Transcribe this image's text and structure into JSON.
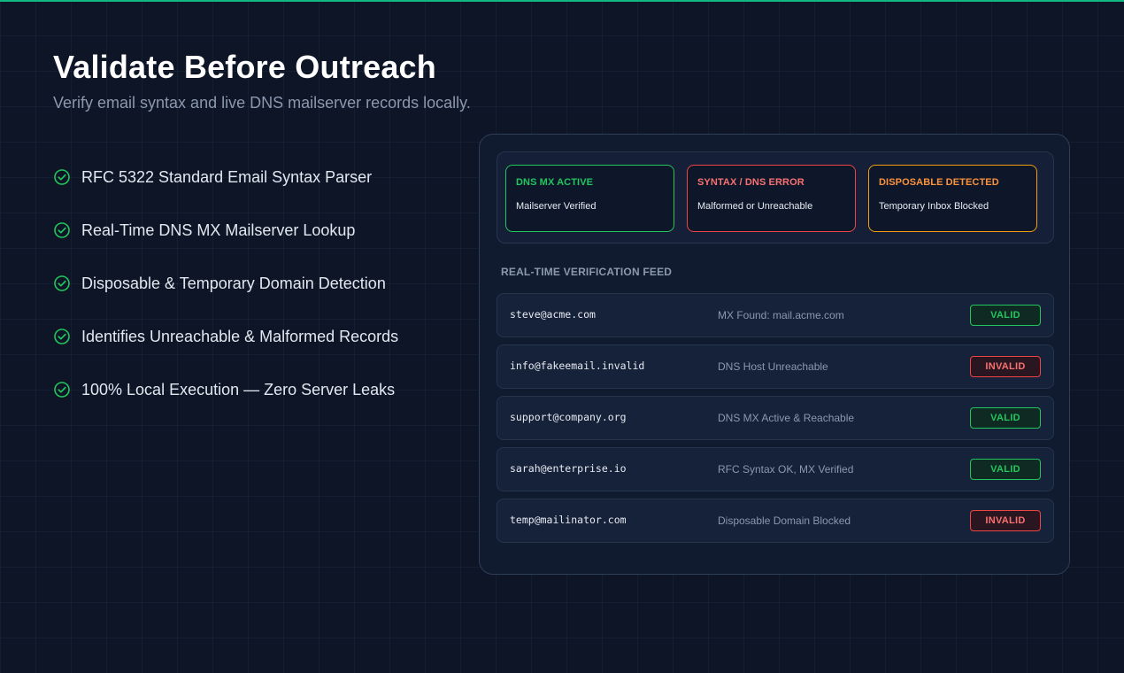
{
  "header": {
    "title": "Validate Before Outreach",
    "subtitle": "Verify email syntax and live DNS mailserver records locally."
  },
  "features": [
    {
      "icon": "check-circle-icon",
      "label": "RFC 5322 Standard Email Syntax Parser"
    },
    {
      "icon": "check-circle-icon",
      "label": "Real-Time DNS MX Mailserver Lookup"
    },
    {
      "icon": "check-circle-icon",
      "label": "Disposable & Temporary Domain Detection"
    },
    {
      "icon": "check-circle-icon",
      "label": "Identifies Unreachable & Malformed Records"
    },
    {
      "icon": "check-circle-icon",
      "label": "100% Local Execution — Zero Server Leaks"
    }
  ],
  "legend": [
    {
      "title": "DNS MX ACTIVE",
      "description": "Mailserver Verified",
      "color": "#22c55e"
    },
    {
      "title": "SYNTAX / DNS ERROR",
      "description": "Malformed or Unreachable",
      "color": "#ef4444"
    },
    {
      "title": "DISPOSABLE DETECTED",
      "description": "Temporary Inbox Blocked",
      "color": "#f59e0b"
    }
  ],
  "feed": {
    "heading": "REAL-TIME VERIFICATION FEED",
    "rows": [
      {
        "email": "steve@acme.com",
        "status": "MX Found: mail.acme.com",
        "badge": "VALID"
      },
      {
        "email": "info@fakeemail.invalid",
        "status": "DNS Host Unreachable",
        "badge": "INVALID"
      },
      {
        "email": "support@company.org",
        "status": "DNS MX Active & Reachable",
        "badge": "VALID"
      },
      {
        "email": "sarah@enterprise.io",
        "status": "RFC Syntax OK, MX Verified",
        "badge": "VALID"
      },
      {
        "email": "temp@mailinator.com",
        "status": "Disposable Domain Blocked",
        "badge": "INVALID"
      }
    ]
  },
  "colors": {
    "accent": "#10b981",
    "valid": "#22c55e",
    "invalid": "#ef4444",
    "disposable": "#f59e0b",
    "background": "#0d1526"
  }
}
